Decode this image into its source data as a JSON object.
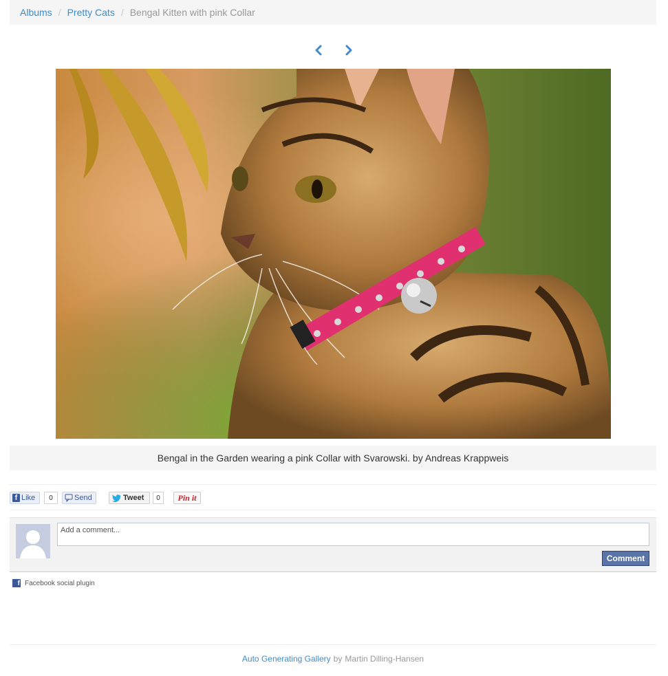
{
  "breadcrumb": {
    "items": [
      "Albums",
      "Pretty Cats"
    ],
    "current": "Bengal Kitten with pink Collar",
    "separator": "/"
  },
  "nav": {
    "prev_icon": "chevron-left-icon",
    "next_icon": "chevron-right-icon"
  },
  "photo": {
    "subject": "bengal-kitten-photo"
  },
  "caption": {
    "text": "Bengal in the Garden wearing a pink Collar with Svarowski. by Andreas Krappweis"
  },
  "social": {
    "fb_like_label": "Like",
    "fb_like_count": "0",
    "fb_send_label": "Send",
    "tweet_label": "Tweet",
    "tweet_count": "0",
    "pin_label": "Pin it"
  },
  "comments": {
    "placeholder": "Add a comment...",
    "button_label": "Comment",
    "plugin_label": "Facebook social plugin"
  },
  "footer": {
    "link_text": "Auto Generating Gallery",
    "by_text": "by",
    "author": "Martin Dilling-Hansen"
  },
  "colors": {
    "link": "#428bca",
    "facebook": "#3b5998",
    "collar_pink": "#e0306f"
  }
}
